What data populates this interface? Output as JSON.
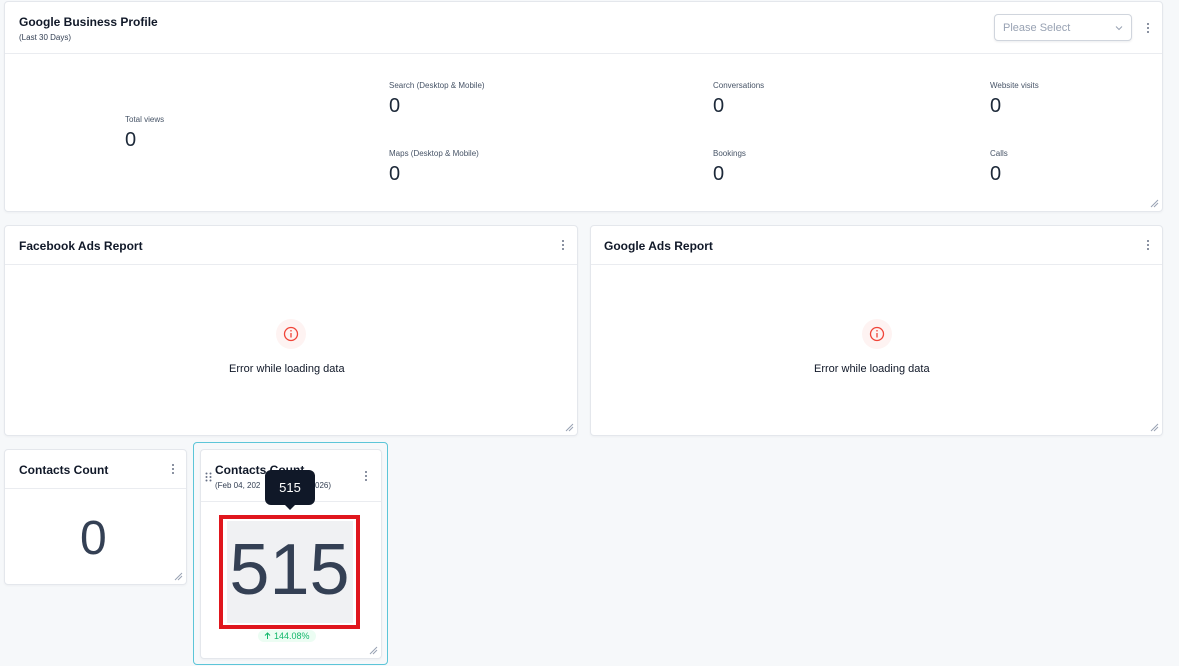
{
  "gbp": {
    "title": "Google Business Profile",
    "subtitle": "(Last 30 Days)",
    "select_placeholder": "Please Select",
    "total": {
      "label": "Total views",
      "value": "0"
    },
    "stats": [
      {
        "label": "Search (Desktop & Mobile)",
        "value": "0"
      },
      {
        "label": "Conversations",
        "value": "0"
      },
      {
        "label": "Website visits",
        "value": "0"
      },
      {
        "label": "Maps (Desktop & Mobile)",
        "value": "0"
      },
      {
        "label": "Bookings",
        "value": "0"
      },
      {
        "label": "Calls",
        "value": "0"
      }
    ]
  },
  "facebook_ads": {
    "title": "Facebook Ads Report",
    "error": "Error while loading data"
  },
  "google_ads": {
    "title": "Google Ads Report",
    "error": "Error while loading data"
  },
  "contacts1": {
    "title": "Contacts Count",
    "value": "0"
  },
  "contacts2": {
    "title": "Contacts Count",
    "subtitle": "(Feb 04, 202",
    "subtitle_end": "026)",
    "value": "515",
    "tooltip": "515",
    "change": "144.08%"
  },
  "colors": {
    "accent_border": "#5cc5d8",
    "error_red": "#f04438",
    "highlight_red": "#e0161d",
    "positive_green": "#12b76a"
  },
  "icons": [
    "kebab-menu-icon",
    "resize-handle-icon",
    "chevron-down-icon",
    "info-circle-icon",
    "drag-handle-icon",
    "arrow-up-icon"
  ]
}
